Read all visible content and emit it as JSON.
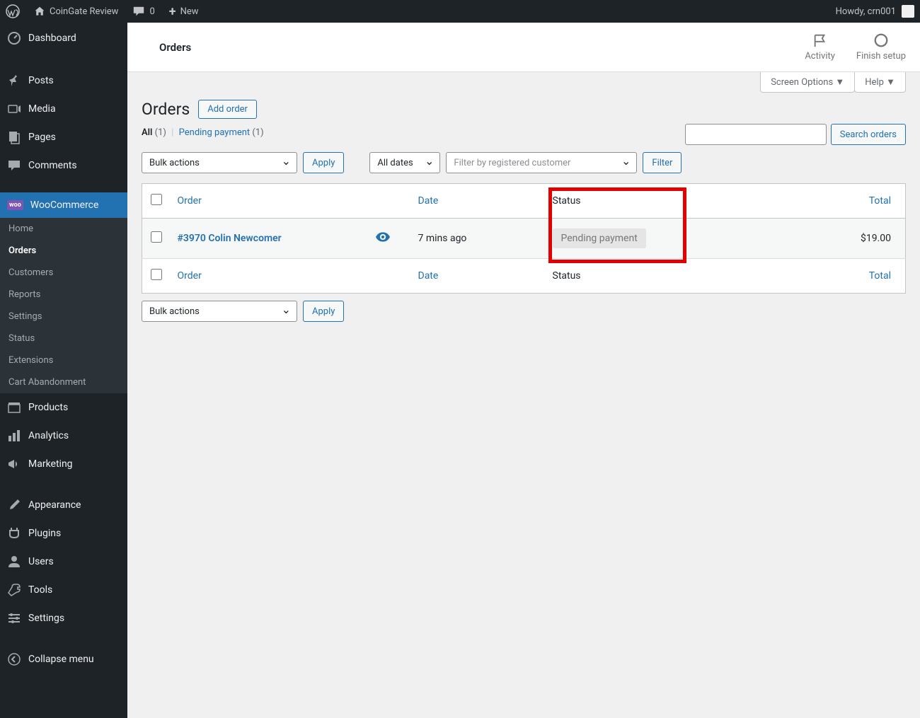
{
  "adminBar": {
    "siteName": "CoinGate Review",
    "commentsCount": "0",
    "newLabel": "New",
    "greeting": "Howdy, crn001"
  },
  "sidebar": {
    "dashboard": "Dashboard",
    "posts": "Posts",
    "media": "Media",
    "pages": "Pages",
    "comments": "Comments",
    "woocommerce": "WooCommerce",
    "woo": {
      "home": "Home",
      "orders": "Orders",
      "customers": "Customers",
      "reports": "Reports",
      "settings": "Settings",
      "status": "Status",
      "extensions": "Extensions",
      "cartAbandonment": "Cart Abandonment"
    },
    "products": "Products",
    "analytics": "Analytics",
    "marketing": "Marketing",
    "appearance": "Appearance",
    "plugins": "Plugins",
    "users": "Users",
    "tools": "Tools",
    "settings": "Settings",
    "collapse": "Collapse menu"
  },
  "header": {
    "title": "Orders",
    "activity": "Activity",
    "finishSetup": "Finish setup"
  },
  "tabs": {
    "screenOptions": "Screen Options",
    "help": "Help"
  },
  "page": {
    "title": "Orders",
    "addButton": "Add order",
    "filters": {
      "all": "All",
      "allCount": "(1)",
      "pending": "Pending payment",
      "pendingCount": "(1)"
    },
    "searchButton": "Search orders",
    "bulkActions": "Bulk actions",
    "apply": "Apply",
    "allDates": "All dates",
    "filterByCustomer": "Filter by registered customer",
    "filter": "Filter"
  },
  "table": {
    "headers": {
      "order": "Order",
      "date": "Date",
      "status": "Status",
      "total": "Total"
    },
    "rows": [
      {
        "order": "#3970 Colin Newcomer",
        "date": "7 mins ago",
        "status": "Pending payment",
        "total": "$19.00"
      }
    ]
  }
}
